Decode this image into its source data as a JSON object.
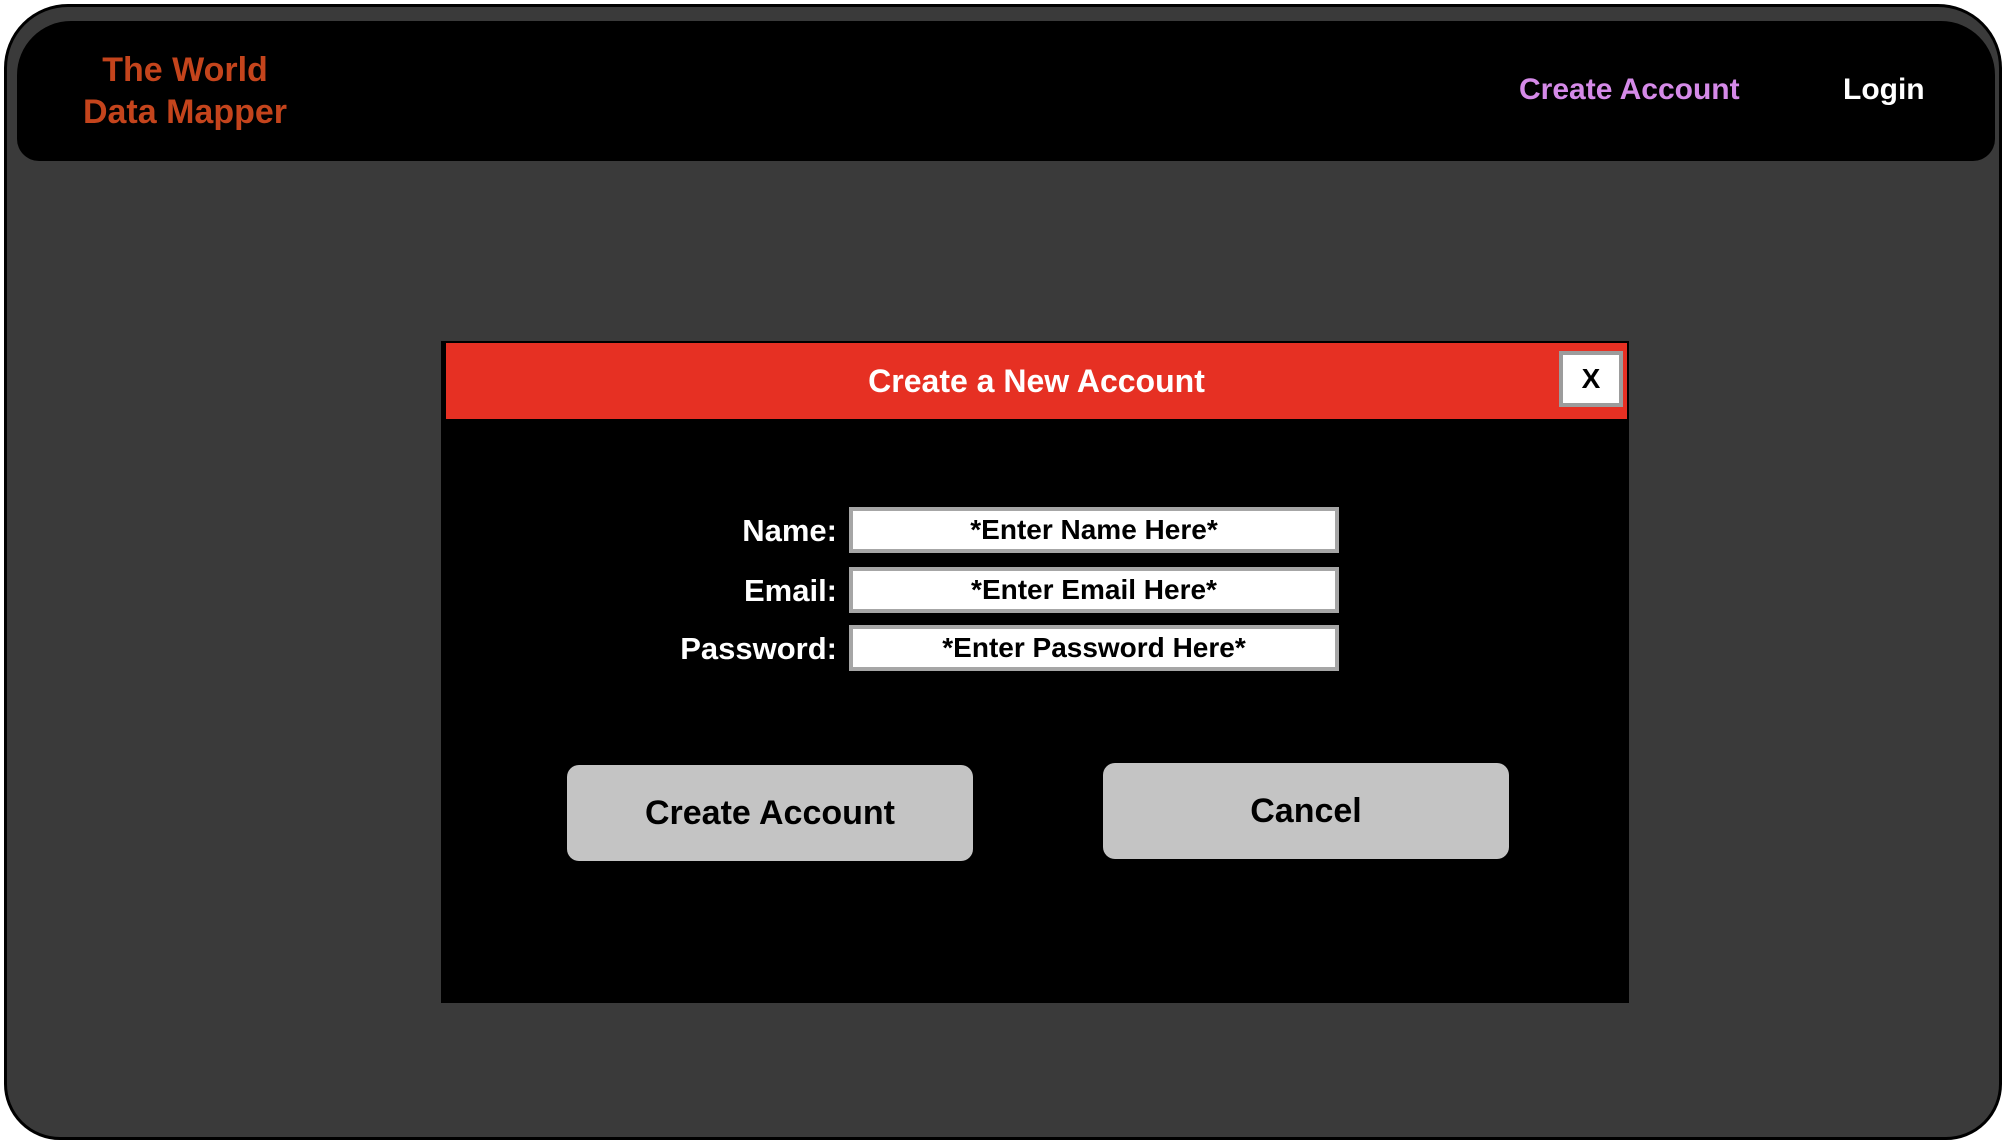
{
  "colors": {
    "page_background": "#3a3a3a",
    "topbar_background": "#000000",
    "brand_color": "#c4441c",
    "nav_create_color": "#d58ae8",
    "nav_login_color": "#ffffff",
    "modal_header_color": "#e63023",
    "button_color": "#c4c4c4"
  },
  "header": {
    "brand_line1": "The World",
    "brand_line2": "Data Mapper",
    "nav": {
      "create_account": "Create Account",
      "login": "Login"
    }
  },
  "modal": {
    "title": "Create a New Account",
    "close_label": "X",
    "fields": {
      "name": {
        "label": "Name:",
        "placeholder": "*Enter Name Here*"
      },
      "email": {
        "label": "Email:",
        "placeholder": "*Enter Email Here*"
      },
      "password": {
        "label": "Password:",
        "placeholder": "*Enter Password Here*"
      }
    },
    "buttons": {
      "create": "Create Account",
      "cancel": "Cancel"
    }
  }
}
